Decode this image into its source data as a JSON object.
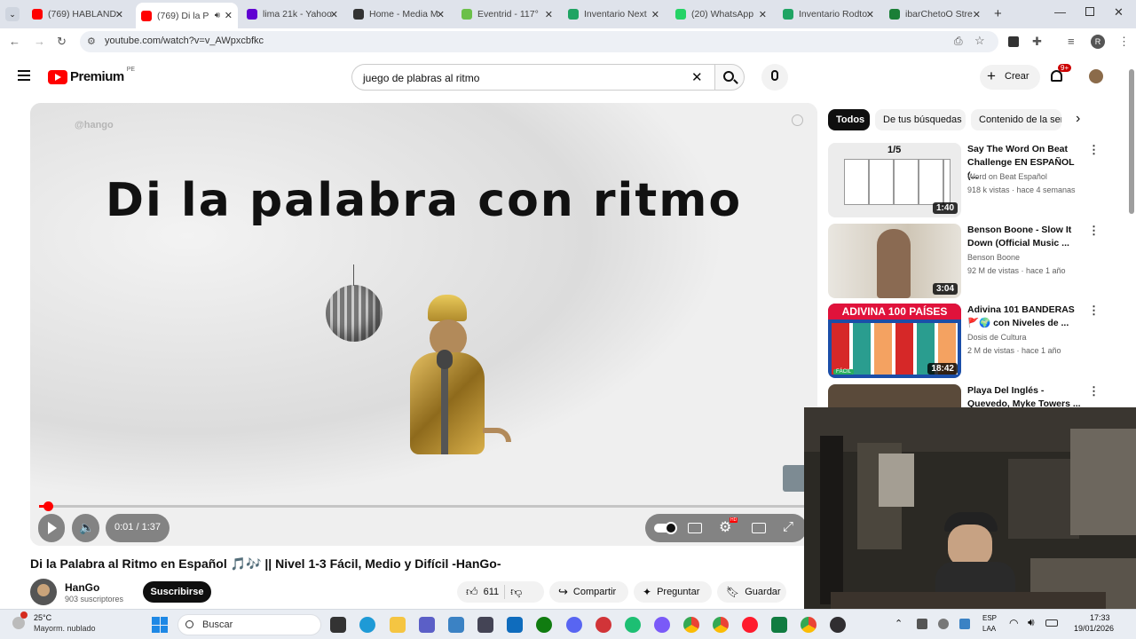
{
  "browser": {
    "tabs": [
      {
        "label": "(769) HABLAND",
        "color": "#ff0000"
      },
      {
        "label": "(769) Di la P",
        "color": "#ff0000",
        "active": true
      },
      {
        "label": "lima 21k - Yahoo",
        "color": "#6001d2"
      },
      {
        "label": "Home - Media M",
        "color": "#333333"
      },
      {
        "label": "Eventrid - 117°",
        "color": "#6cc04a"
      },
      {
        "label": "Inventario Next",
        "color": "#1fa463"
      },
      {
        "label": "(20) WhatsApp",
        "color": "#25d366"
      },
      {
        "label": "Inventario Rodto",
        "color": "#1fa463"
      },
      {
        "label": "ibarChetoO Stre",
        "color": "#1a7f37"
      }
    ],
    "url": "youtube.com/watch?v=v_AWpxcbfkc",
    "profile_initial": "R"
  },
  "youtube": {
    "logo_text": "Premium",
    "logo_region": "PE",
    "search_value": "juego de plabras al ritmo",
    "create_label": "Crear",
    "notif_count": "9+"
  },
  "video": {
    "watermark": "@hango",
    "overlay_text": "Di la palabra con ritmo",
    "time_display": "0:01 / 1:37",
    "progress": 0.011
  },
  "meta": {
    "title": "Di la Palabra al Ritmo en Español 🎵🎶 || Nivel 1-3 Fácil, Medio y Difícil -HanGo-",
    "channel": "HanGo",
    "subscribers": "903 suscriptores",
    "subscribe_label": "Suscribirse",
    "likes": "611",
    "share_label": "Compartir",
    "ask_label": "Preguntar",
    "save_label": "Guardar"
  },
  "filters": [
    "Todos",
    "De tus búsquedas",
    "Contenido de la ser"
  ],
  "recommendations": [
    {
      "title": "Say The Word On Beat Challenge EN ESPAÑOL (...",
      "channel": "Word on Beat Español",
      "stats": "918 k vistas · hace 4 semanas",
      "duration": "1:40",
      "thumb_text": "1/5"
    },
    {
      "title": "Benson Boone - Slow It Down (Official Music ...",
      "channel": "Benson Boone",
      "stats": "92 M de vistas · hace 1 año",
      "duration": "3:04"
    },
    {
      "title": "Adivina 101 BANDERAS 🚩🌍 con Niveles de ...",
      "channel": "Dosis de Cultura",
      "stats": "2 M de vistas · hace 1 año",
      "duration": "18:42",
      "thumb_text": "ADIVINA 100 PAÍSES",
      "thumb_badge": "FÁCIL"
    },
    {
      "title": "Playa Del Inglés - Quevedo, Myke Towers ...",
      "channel": "",
      "stats": "",
      "duration": ""
    }
  ],
  "taskbar": {
    "weather_temp": "25°C",
    "weather_desc": "Mayorm. nublado",
    "search_placeholder": "Buscar",
    "lang_top": "ESP",
    "lang_bottom": "LAA",
    "time": "17:33",
    "date": "19/01/2026"
  },
  "colors": {
    "yt_red": "#ff0000",
    "accent_blue": "#0b57d0"
  }
}
